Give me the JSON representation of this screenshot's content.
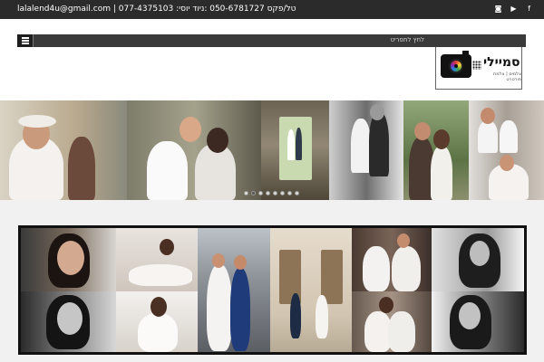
{
  "topbar": {
    "contact_text": "lalalend4u@gmail.com  |  077-4375103 :טל/פקס 050-6781727 :ניוד יוסי",
    "social": [
      {
        "icon": "instagram-icon",
        "glyph": "◙"
      },
      {
        "icon": "youtube-icon",
        "glyph": "▶"
      },
      {
        "icon": "facebook-icon",
        "glyph": "f"
      }
    ]
  },
  "nav": {
    "menu_item": "לחץ לתפריט"
  },
  "logo": {
    "brand": "סמיילי",
    "tagline": "צלמים | צלמת פורטרט"
  },
  "hero": {
    "slides": 8,
    "active_slide": 1
  },
  "colors": {
    "topbar": "#2b2b2b",
    "menubar": "#3a3a3a",
    "gallery_band": "#f1f1f1"
  }
}
